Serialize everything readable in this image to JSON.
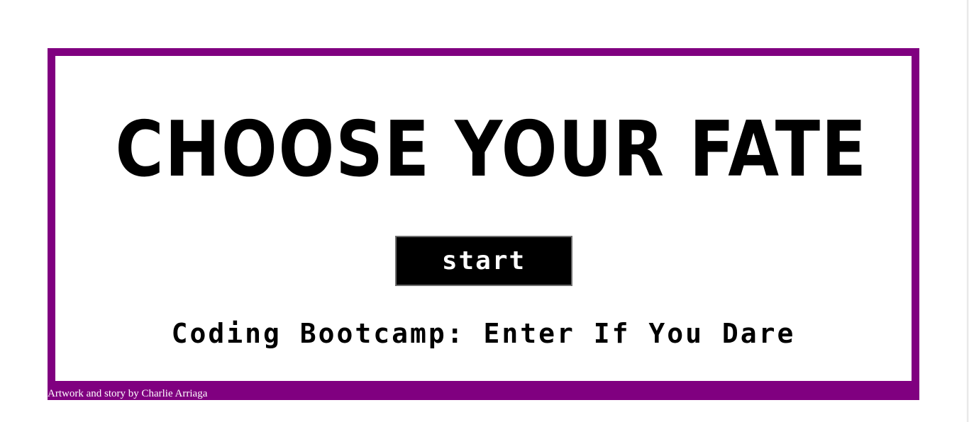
{
  "main": {
    "title": "CHOOSE YOUR FATE",
    "start_label": "start",
    "subtitle": "Coding Bootcamp: Enter If You Dare"
  },
  "footer": {
    "credit": "Artwork and story by Charlie Arriaga"
  },
  "colors": {
    "frame": "#800080",
    "background": "#ffffff",
    "button_bg": "#000000",
    "button_text": "#ffffff",
    "text": "#000000"
  }
}
